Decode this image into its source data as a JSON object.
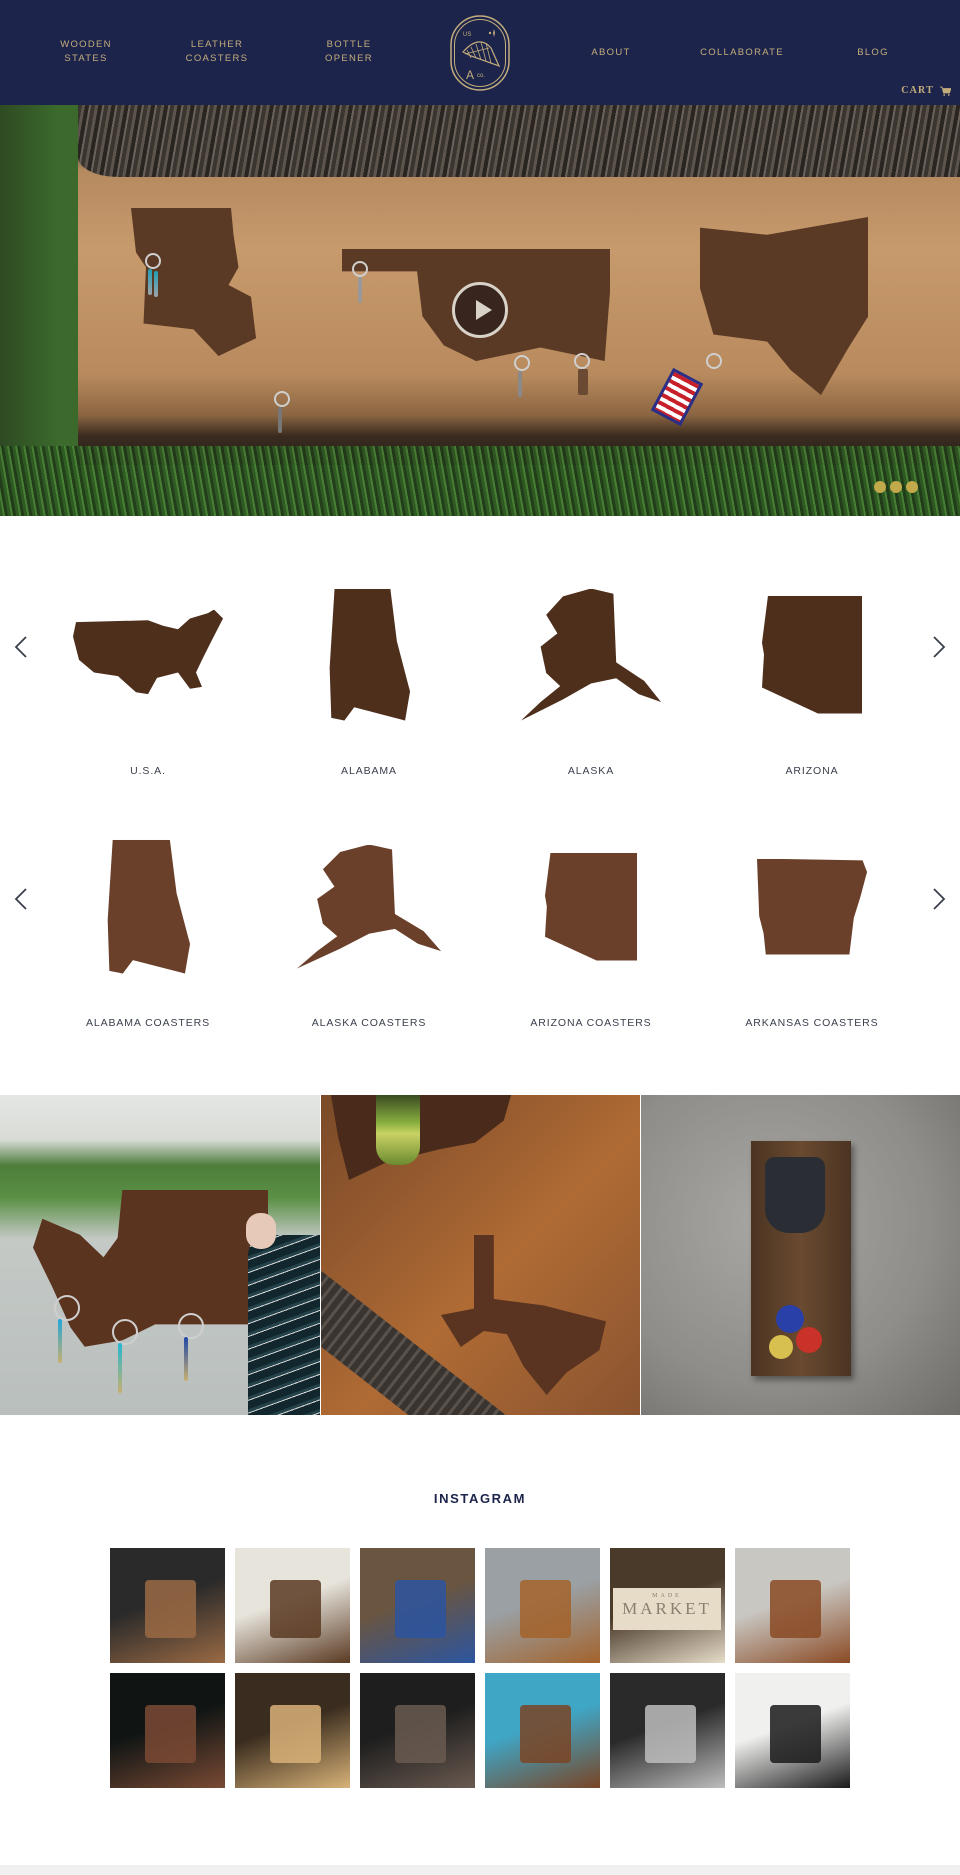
{
  "header": {
    "nav_left": [
      {
        "line1": "Wooden",
        "line2": "States"
      },
      {
        "line1": "Leather",
        "line2": "Coasters"
      },
      {
        "line1": "Bottle",
        "line2": "Opener"
      }
    ],
    "nav_right": [
      {
        "label": "About"
      },
      {
        "label": "Collaborate"
      },
      {
        "label": "Blog"
      }
    ],
    "logo": {
      "top_left": "US",
      "bottom": "A",
      "bottom_suffix": "co."
    },
    "cart_label": "CART",
    "cart_icon": "cart-icon"
  },
  "hero": {
    "play_icon": "play-icon",
    "slides_total": 3,
    "active_slide": 1
  },
  "carousels": [
    {
      "products": [
        {
          "name": "U.S.A.",
          "shape": "usa"
        },
        {
          "name": "ALABAMA",
          "shape": "alabama"
        },
        {
          "name": "ALASKA",
          "shape": "alaska"
        },
        {
          "name": "ARIZONA",
          "shape": "arizona"
        }
      ]
    },
    {
      "products": [
        {
          "name": "ALABAMA COASTERS",
          "shape": "alabama"
        },
        {
          "name": "ALASKA COASTERS",
          "shape": "alaska"
        },
        {
          "name": "ARIZONA COASTERS",
          "shape": "arizona"
        },
        {
          "name": "ARKANSAS COASTERS",
          "shape": "arkansas"
        }
      ]
    }
  ],
  "lifestyle": [
    {
      "subject": "Washington key holder"
    },
    {
      "subject": "Texas coasters with bottle"
    },
    {
      "subject": "Wall bottle opener with caps"
    }
  ],
  "instagram": {
    "title": "INSTAGRAM",
    "tiles": [
      {
        "subject": "Virginia wooden states display",
        "colors": [
          "#2a2a2a",
          "#9a6a44"
        ]
      },
      {
        "subject": "Bottle opener on white",
        "colors": [
          "#e7e4dc",
          "#5a3a22"
        ]
      },
      {
        "subject": "Succulent and state on table",
        "colors": [
          "#6a5540",
          "#2c55a0"
        ]
      },
      {
        "subject": "Texas on live edge",
        "colors": [
          "#9aa0a4",
          "#a3632c"
        ]
      },
      {
        "subject": "Made Market sign",
        "colors": [
          "#4a3a2a",
          "#e6dcc8"
        ],
        "sign_line1": "MADE",
        "sign_line2": "MARKET"
      },
      {
        "subject": "USA keyholder on concrete",
        "colors": [
          "#c9c7c2",
          "#8a4a24"
        ]
      },
      {
        "subject": "Engraved leather logo",
        "colors": [
          "#101514",
          "#7a4a34"
        ]
      },
      {
        "subject": "CNC machine",
        "colors": [
          "#3a2c1e",
          "#d8b278"
        ]
      },
      {
        "subject": "Hands sanding wood",
        "colors": [
          "#1e1e1e",
          "#6a5a50"
        ]
      },
      {
        "subject": "Texas keyholder on blue",
        "colors": [
          "#3fa6c6",
          "#7a4424"
        ]
      },
      {
        "subject": "Lumber in barn",
        "colors": [
          "#2a2a2a",
          "#bdbdbd"
        ]
      },
      {
        "subject": "Framed botanical print",
        "colors": [
          "#f0f0ef",
          "#1a1a1a"
        ]
      }
    ]
  },
  "colors": {
    "navy": "#1c244b",
    "gold": "#c4ad7c",
    "dot_gold": "#c2a94a",
    "label_text": "#3a3f4c"
  }
}
